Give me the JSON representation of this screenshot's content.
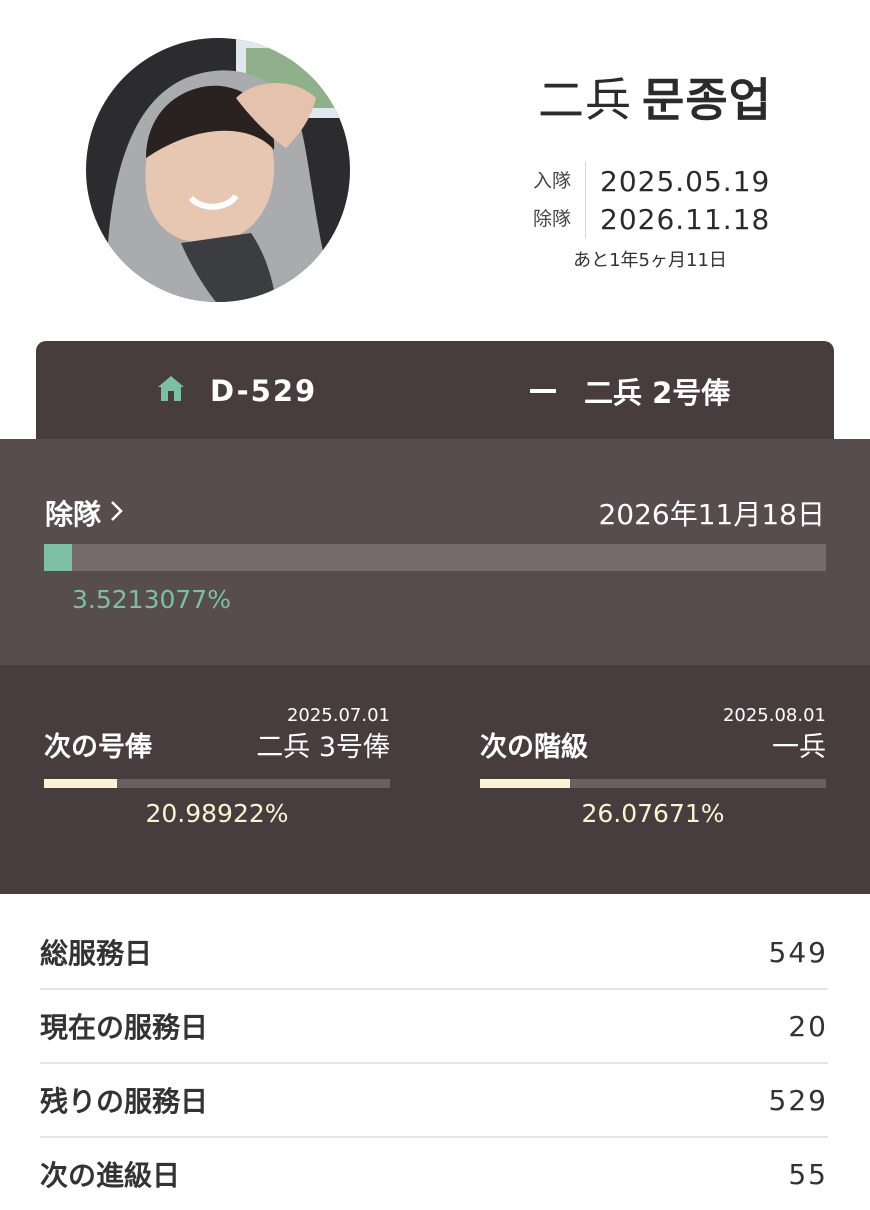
{
  "profile": {
    "rank": "二兵",
    "name": "문종업",
    "enlist_label": "入隊",
    "enlist_date": "2025.05.19",
    "discharge_label": "除隊",
    "discharge_date": "2026.11.18",
    "remaining_text": "あと1年5ヶ月11日"
  },
  "tabs": {
    "dday": "D-529",
    "dday_icon": "home-icon",
    "rank_pay": "二兵 2号俸",
    "rank_icon": "private-rank-insignia-icon"
  },
  "discharge": {
    "label": "除隊",
    "date_text": "2026年11月18日",
    "percent_text": "3.5213077%",
    "fraction": 0.035213077
  },
  "next_pay": {
    "date": "2025.07.01",
    "title": "次の号俸",
    "target": "二兵 3号俸",
    "percent_text": "20.98922%",
    "fraction": 0.2098922
  },
  "next_rank": {
    "date": "2025.08.01",
    "title": "次の階級",
    "target": "一兵",
    "percent_text": "26.07671%",
    "fraction": 0.2607671
  },
  "stats": [
    {
      "label": "総服務日",
      "value": "549"
    },
    {
      "label": "現在の服務日",
      "value": "20"
    },
    {
      "label": "残りの服務日",
      "value": "529"
    },
    {
      "label": "次の進級日",
      "value": "55"
    }
  ],
  "colors": {
    "dark": "#473d3e",
    "mid": "#574d4e",
    "accent_green": "#7dbfa4",
    "accent_cream": "#fdf3d2"
  }
}
